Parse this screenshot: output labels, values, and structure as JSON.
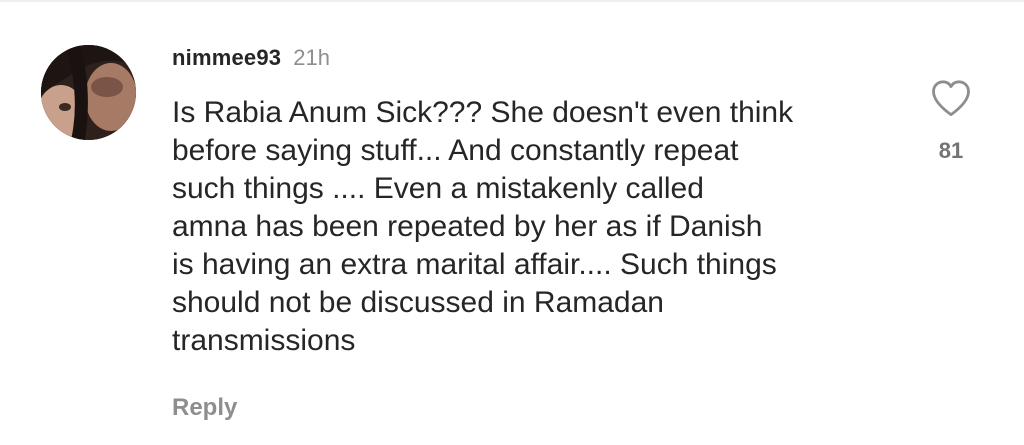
{
  "comment": {
    "username": "nimmee93",
    "timestamp": "21h",
    "text": "Is  Rabia Anum Sick??? She doesn't even think\nbefore saying stuff... And constantly repeat\nsuch things .... Even a mistakenly called\namna has been repeated by her as if Danish\nis having an extra marital affair.... Such things\nshould not be discussed in Ramadan\ntransmissions",
    "reply_label": "Reply",
    "like_count": "81",
    "like_icon": "heart-outline-icon",
    "avatar_icon": "user-avatar-photo"
  },
  "colors": {
    "text_primary": "#262626",
    "text_secondary": "#8e8e8e",
    "background": "#ffffff"
  }
}
